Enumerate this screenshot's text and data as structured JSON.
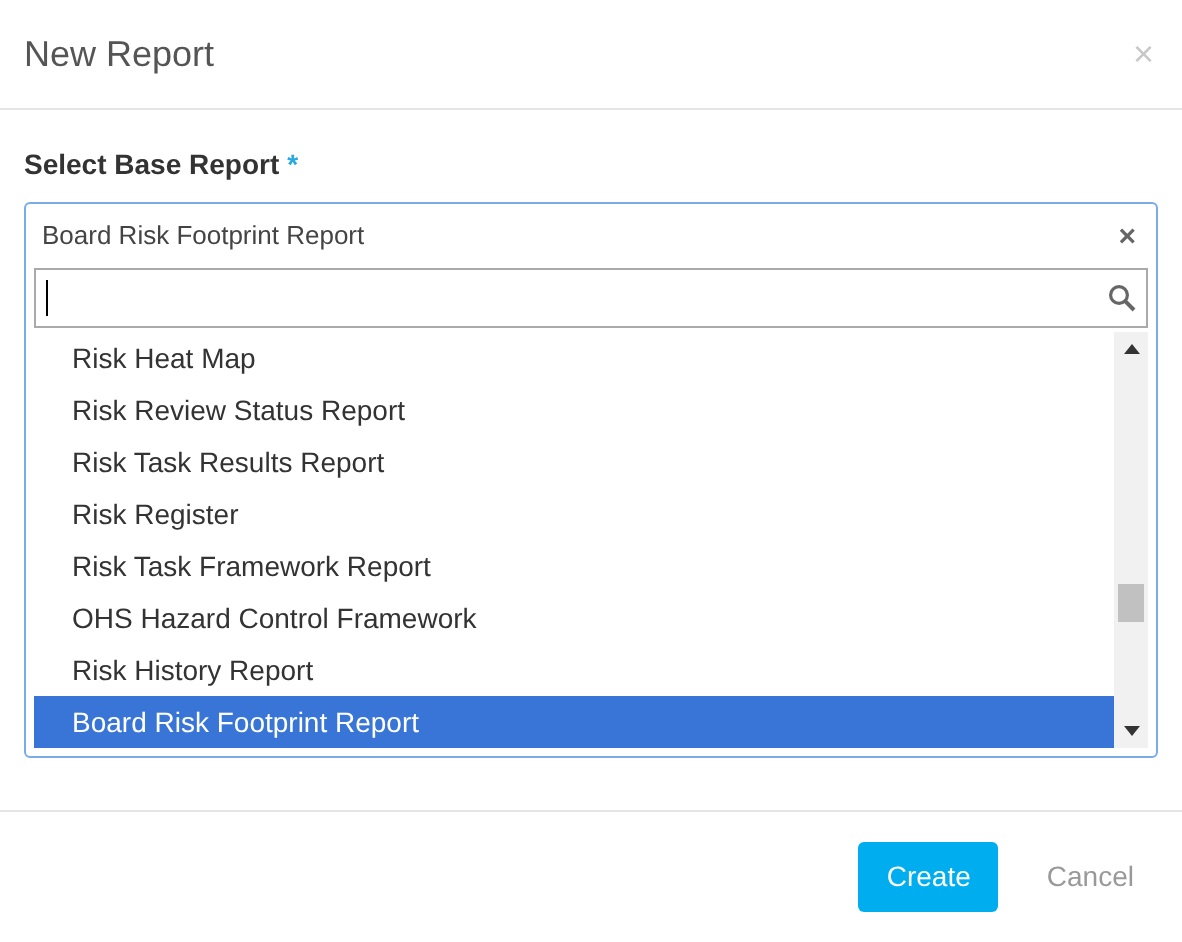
{
  "dialog": {
    "title": "New Report",
    "close": "×"
  },
  "field": {
    "label": "Select Base Report",
    "required": "*",
    "value": "Board Risk Footprint Report",
    "clear": "×"
  },
  "options": [
    {
      "label": "Risk Heat Map",
      "selected": false
    },
    {
      "label": "Risk Review Status Report",
      "selected": false
    },
    {
      "label": "Risk Task Results Report",
      "selected": false
    },
    {
      "label": "Risk Register",
      "selected": false
    },
    {
      "label": "Risk Task Framework Report",
      "selected": false
    },
    {
      "label": "OHS Hazard Control Framework",
      "selected": false
    },
    {
      "label": "Risk History Report",
      "selected": false
    },
    {
      "label": "Board Risk Footprint Report",
      "selected": true
    }
  ],
  "buttons": [
    {
      "label": "Create",
      "kind": "primary"
    },
    {
      "label": "Cancel",
      "kind": "secondary"
    }
  ]
}
